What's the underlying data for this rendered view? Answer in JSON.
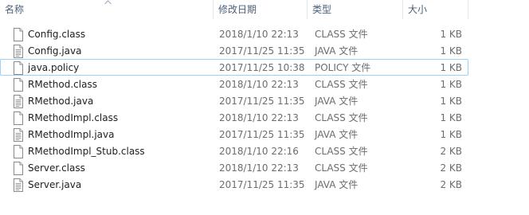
{
  "columns": {
    "name": "名称",
    "date": "修改日期",
    "type": "类型",
    "size": "大小"
  },
  "files": [
    {
      "name": "Config.class",
      "date": "2018/1/10 22:13",
      "type": "CLASS 文件",
      "size": "1 KB",
      "icon": "file-icon",
      "selected": false
    },
    {
      "name": "Config.java",
      "date": "2017/11/25 11:35",
      "type": "JAVA 文件",
      "size": "1 KB",
      "icon": "text-file-icon",
      "selected": false
    },
    {
      "name": "java.policy",
      "date": "2017/11/25 10:38",
      "type": "POLICY 文件",
      "size": "1 KB",
      "icon": "file-icon",
      "selected": true
    },
    {
      "name": "RMethod.class",
      "date": "2018/1/10 22:13",
      "type": "CLASS 文件",
      "size": "1 KB",
      "icon": "file-icon",
      "selected": false
    },
    {
      "name": "RMethod.java",
      "date": "2017/11/25 11:35",
      "type": "JAVA 文件",
      "size": "1 KB",
      "icon": "text-file-icon",
      "selected": false
    },
    {
      "name": "RMethodImpl.class",
      "date": "2018/1/10 22:13",
      "type": "CLASS 文件",
      "size": "1 KB",
      "icon": "file-icon",
      "selected": false
    },
    {
      "name": "RMethodImpl.java",
      "date": "2017/11/25 11:35",
      "type": "JAVA 文件",
      "size": "1 KB",
      "icon": "text-file-icon",
      "selected": false
    },
    {
      "name": "RMethodImpl_Stub.class",
      "date": "2018/1/10 22:16",
      "type": "CLASS 文件",
      "size": "2 KB",
      "icon": "file-icon",
      "selected": false
    },
    {
      "name": "Server.class",
      "date": "2018/1/10 22:13",
      "type": "CLASS 文件",
      "size": "2 KB",
      "icon": "file-icon",
      "selected": false
    },
    {
      "name": "Server.java",
      "date": "2017/11/25 11:35",
      "type": "JAVA 文件",
      "size": "2 KB",
      "icon": "text-file-icon",
      "selected": false
    }
  ],
  "colors": {
    "header_text": "#4c607a",
    "name_text": "#1e1e1e",
    "detail_text": "#6d6d6d",
    "selection_border": "#99d1ff"
  }
}
